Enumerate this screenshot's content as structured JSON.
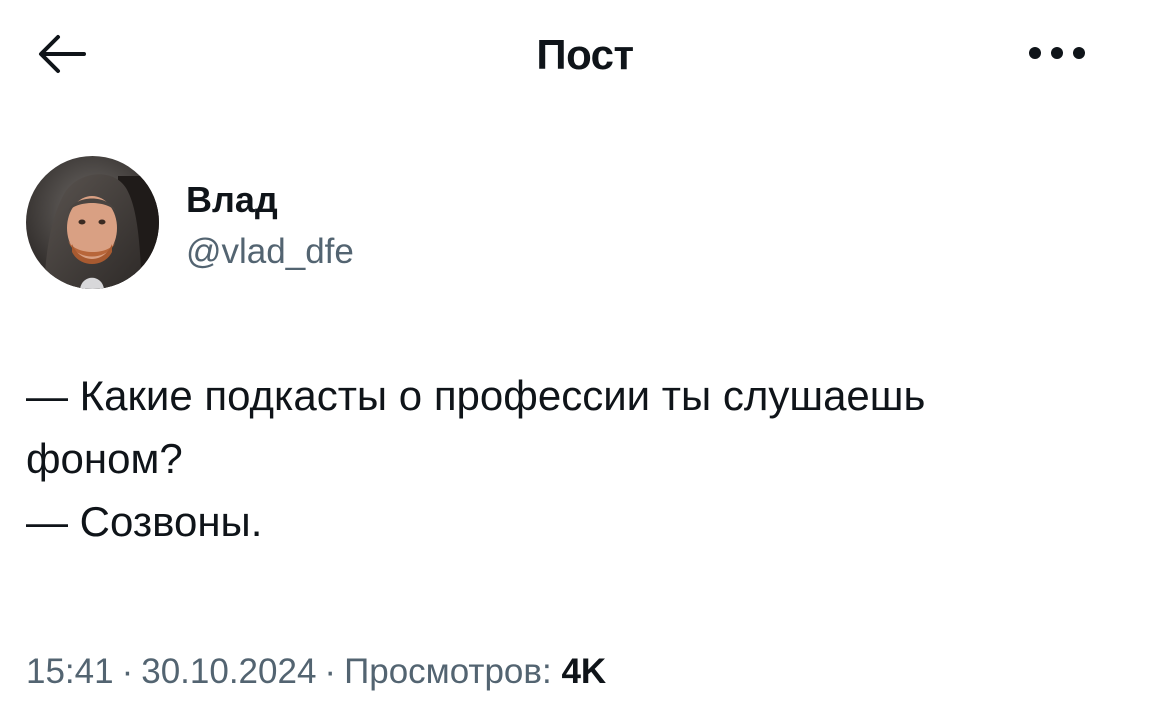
{
  "header": {
    "back_icon": "arrow-left-icon",
    "title": "Пост",
    "more_icon": "more-dots-icon"
  },
  "author": {
    "display_name": "Влад",
    "handle": "@vlad_dfe",
    "avatar_icon": "avatar-photo"
  },
  "post": {
    "lines": [
      "— Какие подкасты о профессии ты слушаешь",
      "фоном?",
      "— Созвоны."
    ]
  },
  "meta": {
    "time": "15:41",
    "separator": "·",
    "date": "30.10.2024",
    "views_label": "Просмотров:",
    "views_count": "4K"
  },
  "colors": {
    "text_primary": "#0f1419",
    "text_secondary": "#536471",
    "background": "#ffffff"
  }
}
